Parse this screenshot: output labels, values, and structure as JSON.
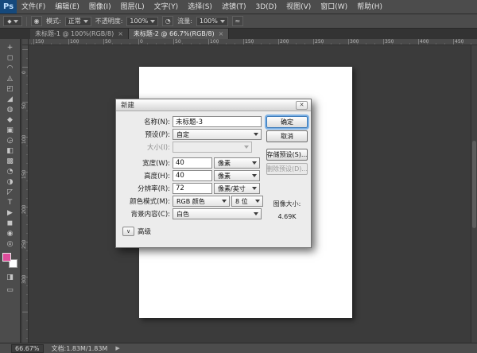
{
  "menubar": {
    "logo": "Ps",
    "items": [
      "文件(F)",
      "编辑(E)",
      "图像(I)",
      "图层(L)",
      "文字(Y)",
      "选择(S)",
      "滤镜(T)",
      "3D(D)",
      "视图(V)",
      "窗口(W)",
      "帮助(H)"
    ]
  },
  "options_bar": {
    "mode_label": "模式:",
    "mode_value": "正常",
    "opacity_label": "不透明度:",
    "opacity_value": "100%",
    "flow_label": "流量:",
    "flow_value": "100%"
  },
  "tabbar": {
    "tabs": [
      {
        "label": "未标题-1 @ 100%(RGB/8)",
        "close": "×"
      },
      {
        "label": "未标题-2 @ 66.7%(RGB/8)",
        "close": "×"
      }
    ]
  },
  "ruler": {
    "h_numbers": [
      "150",
      "100",
      "50",
      "0",
      "50",
      "100",
      "150",
      "200",
      "250",
      "300",
      "350",
      "400",
      "450"
    ],
    "v_numbers": [
      "0",
      "50",
      "100",
      "150",
      "200",
      "250",
      "300"
    ]
  },
  "toolbar": {
    "tools": [
      {
        "glyph": "+"
      },
      {
        "glyph": "◻"
      },
      {
        "glyph": "◠"
      },
      {
        "glyph": "◬"
      },
      {
        "glyph": "◰"
      },
      {
        "glyph": "◢"
      },
      {
        "glyph": "◍"
      },
      {
        "glyph": "◆"
      },
      {
        "glyph": "▣"
      },
      {
        "glyph": "◶"
      },
      {
        "glyph": "◧"
      },
      {
        "glyph": "▩"
      },
      {
        "glyph": "◔"
      },
      {
        "glyph": "◑"
      },
      {
        "glyph": "◸"
      },
      {
        "glyph": "T"
      },
      {
        "glyph": "▶"
      },
      {
        "glyph": "◼"
      },
      {
        "glyph": "◉"
      },
      {
        "glyph": "◎"
      }
    ],
    "foreground_color": "#df4d9b",
    "quick_mask_glyph": "◨",
    "screen_mode_glyph": "▭"
  },
  "dialog": {
    "title": "新建",
    "close_icon": "✕",
    "name_label": "名称(N):",
    "name_value": "未标题-3",
    "preset_label": "预设(P):",
    "preset_value": "自定",
    "size_label": "大小(I):",
    "size_value": "",
    "width_label": "宽度(W):",
    "width_value": "40",
    "width_unit": "像素",
    "height_label": "高度(H):",
    "height_value": "40",
    "height_unit": "像素",
    "resolution_label": "分辨率(R):",
    "resolution_value": "72",
    "resolution_unit": "像素/英寸",
    "mode_label": "颜色模式(M):",
    "mode_value": "RGB 颜色",
    "mode_depth": "8 位",
    "bg_label": "背景内容(C):",
    "bg_value": "白色",
    "ok": "确定",
    "cancel": "取消",
    "save_preset": "存储预设(S)...",
    "delete_preset": "删除预设(D)...",
    "image_size_label": "图像大小:",
    "image_size_value": "4.69K",
    "advanced_icon": "∨",
    "advanced_label": "高级"
  },
  "statusbar": {
    "zoom": "66.67%",
    "doc_info": "文档:1.83M/1.83M",
    "menu_arrow": "▶"
  }
}
